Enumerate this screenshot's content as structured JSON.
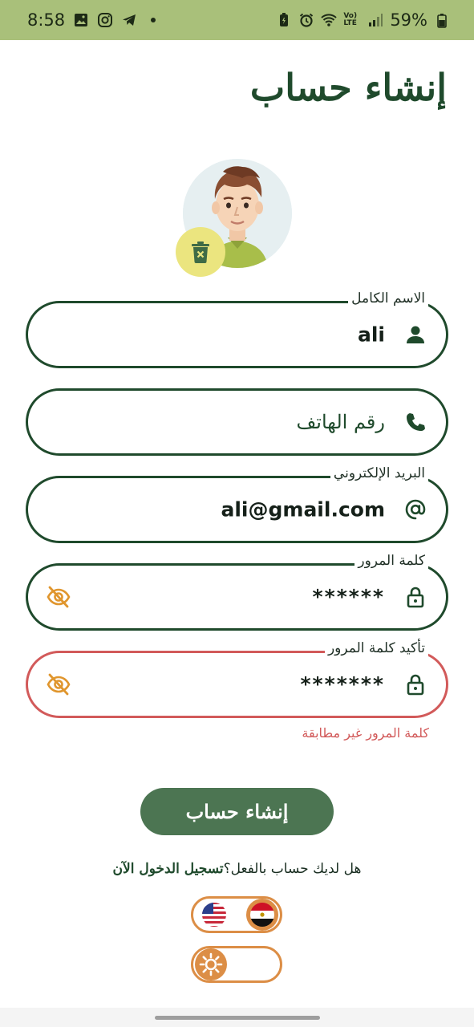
{
  "status_bar": {
    "time": "8:58",
    "battery": "59%",
    "network": "Vo) LTE"
  },
  "title": "إنشاء حساب",
  "fields": {
    "full_name": {
      "label": "الاسم الكامل",
      "value": "ali"
    },
    "phone": {
      "placeholder": "رقم الهاتف"
    },
    "email": {
      "label": "البريد الإلكتروني",
      "value": "ali@gmail.com"
    },
    "password": {
      "label": "كلمة المرور",
      "value": "******"
    },
    "confirm_password": {
      "label": "تأكيد كلمة المرور",
      "value": "*******"
    }
  },
  "error_message": "كلمة المرور غير مطابقة",
  "submit_label": "إنشاء حساب",
  "login_prompt": {
    "question": "هل لديك حساب بالفعل؟",
    "link": "تسجيل الدخول الآن"
  },
  "toggles": {
    "language": {
      "selected": "arabic",
      "options": [
        "english",
        "arabic"
      ]
    },
    "theme": {
      "selected": "light",
      "options": [
        "light",
        "dark"
      ]
    }
  },
  "colors": {
    "primary": "#1f4a2c",
    "accent": "#dc8e46",
    "error": "#d25a5a",
    "button": "#4c7552",
    "status_bar": "#a9c07a"
  },
  "icons": {
    "name": "person-icon",
    "phone": "phone-icon",
    "email": "at-sign-icon",
    "password": "lock-icon",
    "visibility": "eye-off-icon",
    "delete": "trash-icon"
  }
}
